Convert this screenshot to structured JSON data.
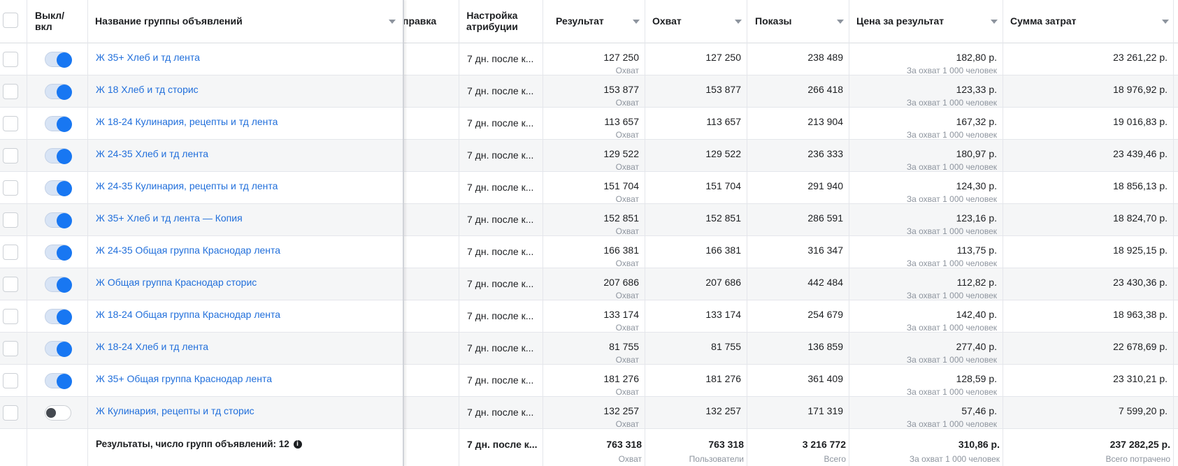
{
  "header": {
    "toggle_col": "Выкл/\nвкл",
    "name_col": "Название группы объявлений",
    "delivery_col": "правка",
    "attribution_col": "Настройка\nатрибуции",
    "result_col": "Результат",
    "reach_col": "Охват",
    "impressions_col": "Показы",
    "cpr_col": "Цена за результат",
    "spend_col": "Сумма затрат"
  },
  "rows": [
    {
      "name": "Ж 35+ Хлеб и тд лента",
      "on": true,
      "attribution": "7 дн. после к...",
      "result": "127 250",
      "result_sub": "Охват",
      "reach": "127 250",
      "impressions": "238 489",
      "cpr": "182,80 р.",
      "cpr_sub": "За охват 1 000 человек",
      "spend": "23 261,22 р."
    },
    {
      "name": "Ж 18 Хлеб и тд сторис",
      "on": true,
      "attribution": "7 дн. после к...",
      "result": "153 877",
      "result_sub": "Охват",
      "reach": "153 877",
      "impressions": "266 418",
      "cpr": "123,33 р.",
      "cpr_sub": "За охват 1 000 человек",
      "spend": "18 976,92 р."
    },
    {
      "name": "Ж 18-24 Кулинария, рецепты и тд лента",
      "on": true,
      "attribution": "7 дн. после к...",
      "result": "113 657",
      "result_sub": "Охват",
      "reach": "113 657",
      "impressions": "213 904",
      "cpr": "167,32 р.",
      "cpr_sub": "За охват 1 000 человек",
      "spend": "19 016,83 р."
    },
    {
      "name": "Ж 24-35 Хлеб и тд лента",
      "on": true,
      "attribution": "7 дн. после к...",
      "result": "129 522",
      "result_sub": "Охват",
      "reach": "129 522",
      "impressions": "236 333",
      "cpr": "180,97 р.",
      "cpr_sub": "За охват 1 000 человек",
      "spend": "23 439,46 р."
    },
    {
      "name": "Ж 24-35 Кулинария, рецепты и тд лента",
      "on": true,
      "attribution": "7 дн. после к...",
      "result": "151 704",
      "result_sub": "Охват",
      "reach": "151 704",
      "impressions": "291 940",
      "cpr": "124,30 р.",
      "cpr_sub": "За охват 1 000 человек",
      "spend": "18 856,13 р."
    },
    {
      "name": "Ж 35+ Хлеб и тд лента — Копия",
      "on": true,
      "attribution": "7 дн. после к...",
      "result": "152 851",
      "result_sub": "Охват",
      "reach": "152 851",
      "impressions": "286 591",
      "cpr": "123,16 р.",
      "cpr_sub": "За охват 1 000 человек",
      "spend": "18 824,70 р."
    },
    {
      "name": "Ж 24-35 Общая группа Краснодар лента",
      "on": true,
      "attribution": "7 дн. после к...",
      "result": "166 381",
      "result_sub": "Охват",
      "reach": "166 381",
      "impressions": "316 347",
      "cpr": "113,75 р.",
      "cpr_sub": "За охват 1 000 человек",
      "spend": "18 925,15 р."
    },
    {
      "name": "Ж Общая группа Краснодар сторис",
      "on": true,
      "attribution": "7 дн. после к...",
      "result": "207 686",
      "result_sub": "Охват",
      "reach": "207 686",
      "impressions": "442 484",
      "cpr": "112,82 р.",
      "cpr_sub": "За охват 1 000 человек",
      "spend": "23 430,36 р."
    },
    {
      "name": "Ж 18-24 Общая группа Краснодар лента",
      "on": true,
      "attribution": "7 дн. после к...",
      "result": "133 174",
      "result_sub": "Охват",
      "reach": "133 174",
      "impressions": "254 679",
      "cpr": "142,40 р.",
      "cpr_sub": "За охват 1 000 человек",
      "spend": "18 963,38 р."
    },
    {
      "name": "Ж 18-24 Хлеб и тд лента",
      "on": true,
      "attribution": "7 дн. после к...",
      "result": "81 755",
      "result_sub": "Охват",
      "reach": "81 755",
      "impressions": "136 859",
      "cpr": "277,40 р.",
      "cpr_sub": "За охват 1 000 человек",
      "spend": "22 678,69 р."
    },
    {
      "name": "Ж 35+ Общая группа Краснодар лента",
      "on": true,
      "attribution": "7 дн. после к...",
      "result": "181 276",
      "result_sub": "Охват",
      "reach": "181 276",
      "impressions": "361 409",
      "cpr": "128,59 р.",
      "cpr_sub": "За охват 1 000 человек",
      "spend": "23 310,21 р."
    },
    {
      "name": "Ж Кулинария, рецепты и тд сторис",
      "on": false,
      "attribution": "7 дн. после к...",
      "result": "132 257",
      "result_sub": "Охват",
      "reach": "132 257",
      "impressions": "171 319",
      "cpr": "57,46 р.",
      "cpr_sub": "За охват 1 000 человек",
      "spend": "7 599,20 р."
    }
  ],
  "totals": {
    "label": "Результаты, число групп объявлений: 12",
    "attribution": "7 дн. после к...",
    "result": "763 318",
    "result_sub": "Охват",
    "reach": "763 318",
    "reach_sub": "Пользователи",
    "impressions": "3 216 772",
    "impressions_sub": "Всего",
    "cpr": "310,86 р.",
    "cpr_sub": "За охват 1 000 человек",
    "spend": "237 282,25 р.",
    "spend_sub": "Всего потрачено"
  },
  "colors": {
    "link": "#216fdb",
    "toggle_on": "#1877f2",
    "toggle_off": "#444950"
  },
  "icons": {
    "info": "info-icon",
    "sort": "sort-arrow-icon"
  }
}
